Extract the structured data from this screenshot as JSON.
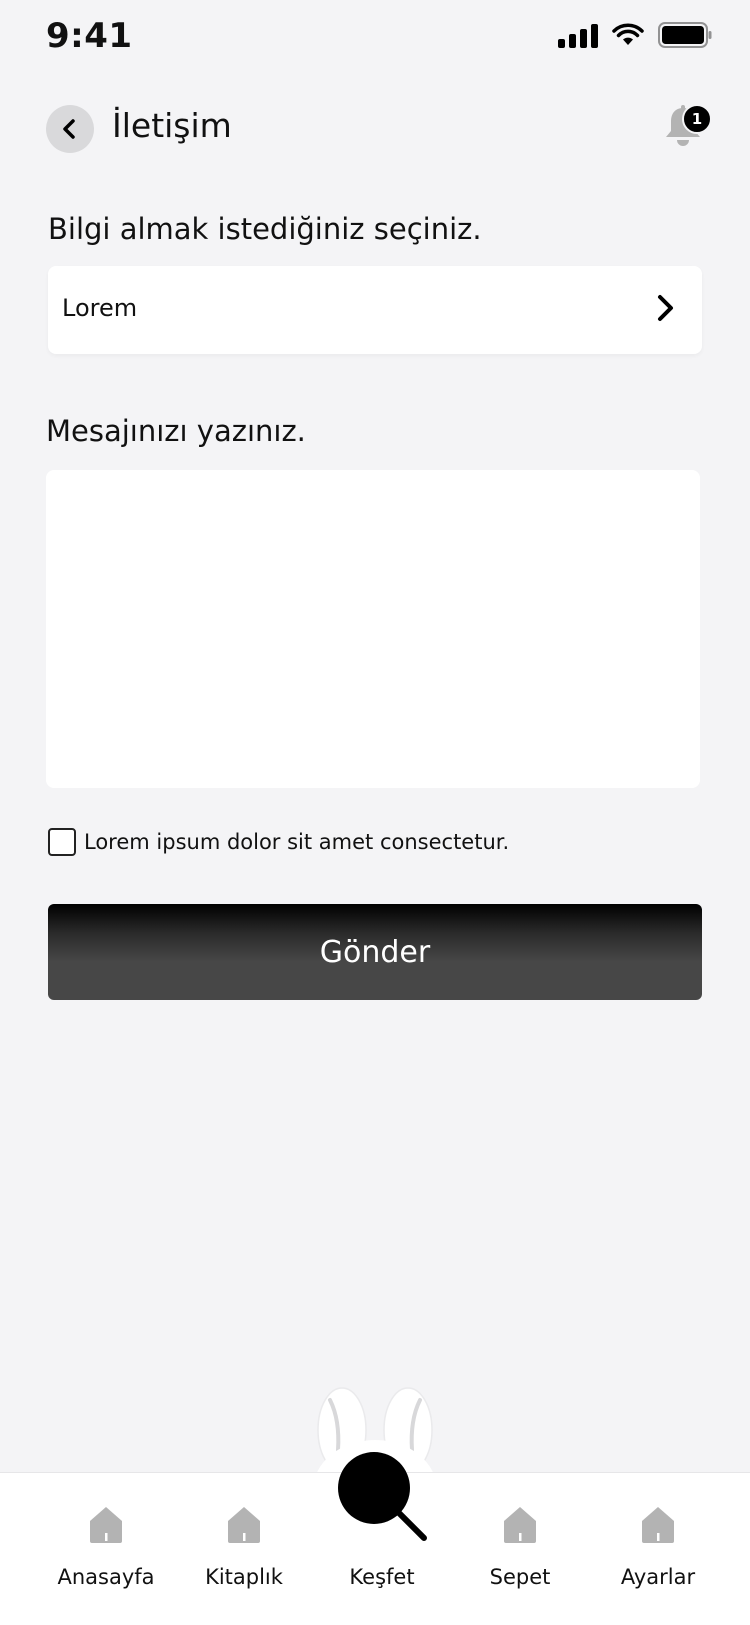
{
  "status_bar": {
    "time": "9:41"
  },
  "header": {
    "title": "İletişim",
    "notification_count": "1"
  },
  "form": {
    "topic_label": "Bilgi almak istediğiniz seçiniz.",
    "topic_value": "Lorem",
    "message_label": "Mesajınızı yazınız.",
    "message_value": "",
    "consent_text": "Lorem ipsum dolor sit amet consectetur.",
    "consent_checked": false,
    "submit_label": "Gönder"
  },
  "tabbar": {
    "items": [
      {
        "label": "Anasayfa",
        "icon": "home-icon"
      },
      {
        "label": "Kitaplık",
        "icon": "home-icon"
      },
      {
        "label": "Keşfet",
        "icon": "search-icon",
        "active": true
      },
      {
        "label": "Sepet",
        "icon": "home-icon"
      },
      {
        "label": "Ayarlar",
        "icon": "home-icon"
      }
    ]
  },
  "colors": {
    "background": "#f4f4f6",
    "surface": "#ffffff",
    "primary_button_dark": "#000000",
    "primary_button_light": "#474747",
    "icon_gray": "#b3b3b3"
  }
}
